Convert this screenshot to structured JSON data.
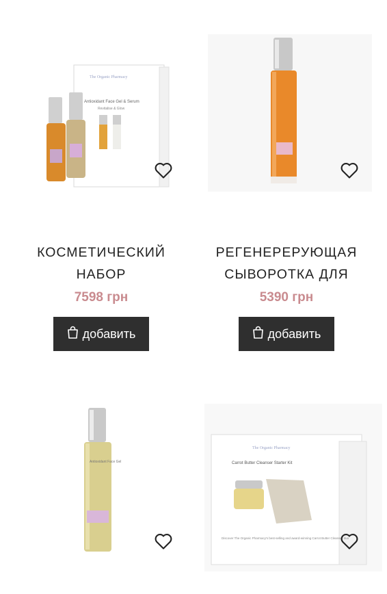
{
  "products": [
    {
      "title_line1": "КОСМЕТИЧЕСКИЙ",
      "title_line2": "НАБОР",
      "price": "7598 грн",
      "cart_label": "добавить",
      "box_brand": "The Organic Pharmacy",
      "box_text": "Antioxidant Face Gel & Serum",
      "box_subtext": "Revitalise & Glow"
    },
    {
      "title_line1": "РЕГЕНЕРЕРУЮЩАЯ",
      "title_line2": "СЫВОРОТКА ДЛЯ",
      "price": "5390 грн",
      "cart_label": "добавить"
    },
    {
      "bottle_text": "Antioxidant Face Gel"
    },
    {
      "box_brand": "The Organic Pharmacy",
      "box_text": "Carrot Butter Cleanser Starter Kit",
      "box_caption": "Discover The Organic Pharmacy's best-selling and award-winning Carrot Butter Cleanser duo"
    }
  ],
  "colors": {
    "price": "#c98b8f",
    "button_bg": "#2f2f2f",
    "title": "#222222"
  },
  "icons": [
    "wishlist-heart-icon",
    "shopping-bag-icon"
  ]
}
